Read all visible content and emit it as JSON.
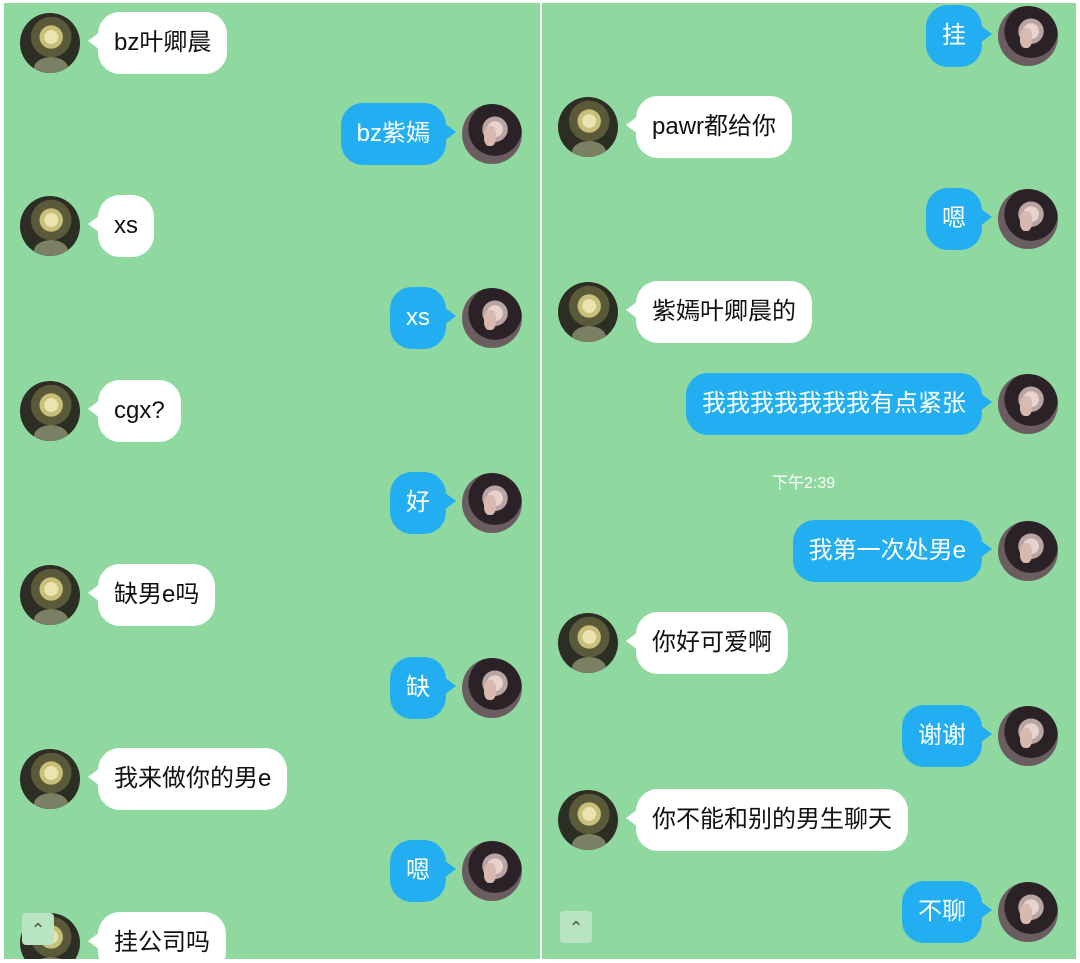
{
  "left_chat": {
    "messages": [
      {
        "side": "in",
        "text": "bz叶卿晨"
      },
      {
        "side": "out",
        "text": "bz紫嫣"
      },
      {
        "side": "in",
        "text": "xs"
      },
      {
        "side": "out",
        "text": "xs"
      },
      {
        "side": "in",
        "text": "cgx?"
      },
      {
        "side": "out",
        "text": "好"
      },
      {
        "side": "in",
        "text": "缺男e吗"
      },
      {
        "side": "out",
        "text": "缺"
      },
      {
        "side": "in",
        "text": "我来做你的男e"
      },
      {
        "side": "out",
        "text": "嗯"
      },
      {
        "side": "in",
        "text": "挂公司吗"
      }
    ],
    "scroll_button": {
      "icon": "chevron-up-icon",
      "glyph": "⌃"
    }
  },
  "right_chat": {
    "messages": [
      {
        "side": "out",
        "text": "挂"
      },
      {
        "side": "in",
        "text": "pawr都给你"
      },
      {
        "side": "out",
        "text": "嗯"
      },
      {
        "side": "in",
        "text": "紫嫣叶卿晨的"
      },
      {
        "side": "out",
        "text": "我我我我我我我有点紧张"
      },
      {
        "side": "out",
        "text": "我第一次处男e"
      },
      {
        "side": "in",
        "text": "你好可爱啊"
      },
      {
        "side": "out",
        "text": "谢谢"
      },
      {
        "side": "in",
        "text": "你不能和别的男生聊天"
      },
      {
        "side": "out",
        "text": "不聊"
      }
    ],
    "timestamp": "下午2:39",
    "scroll_button": {
      "icon": "chevron-up-icon",
      "glyph": "⌃"
    }
  },
  "colors": {
    "chat_background": "#8fd8a0",
    "outgoing_bubble": "#22aef0",
    "incoming_bubble": "#ffffff"
  }
}
